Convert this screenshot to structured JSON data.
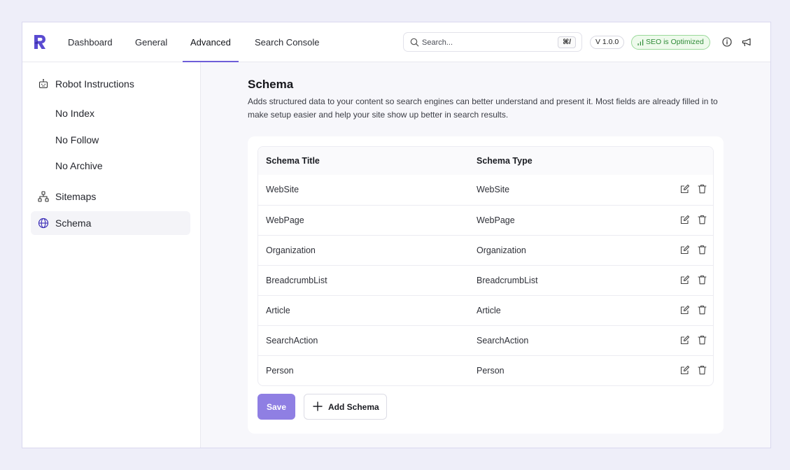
{
  "header": {
    "tabs": [
      {
        "label": "Dashboard"
      },
      {
        "label": "General"
      },
      {
        "label": "Advanced"
      },
      {
        "label": "Search Console"
      }
    ],
    "active_tab": "Advanced",
    "search": {
      "placeholder": "Search...",
      "shortcut": "⌘/"
    },
    "version": "V 1.0.0",
    "seo_status": "SEO is Optimized",
    "icons": [
      "logo-icon",
      "search-icon",
      "info-icon",
      "megaphone-icon"
    ]
  },
  "sidebar": {
    "items": [
      {
        "label": "Robot Instructions",
        "icon": "robot-icon"
      },
      {
        "label": "No Index"
      },
      {
        "label": "No Follow"
      },
      {
        "label": "No Archive"
      },
      {
        "label": "Sitemaps",
        "icon": "sitemap-icon"
      },
      {
        "label": "Schema",
        "icon": "globe-icon",
        "active": true
      }
    ]
  },
  "main": {
    "title": "Schema",
    "description": "Adds structured data to your content so search engines can better understand and present it. Most fields are already filled in to make setup easier and help your site show up better in search results.",
    "table": {
      "columns": [
        "Schema Title",
        "Schema Type"
      ],
      "rows": [
        [
          "WebSite",
          "WebSite"
        ],
        [
          "WebPage",
          "WebPage"
        ],
        [
          "Organization",
          "Organization"
        ],
        [
          "BreadcrumbList",
          "BreadcrumbList"
        ],
        [
          "Article",
          "Article"
        ],
        [
          "SearchAction",
          "SearchAction"
        ],
        [
          "Person",
          "Person"
        ]
      ]
    },
    "save_label": "Save",
    "add_label": "Add Schema"
  },
  "colors": {
    "accent": "#6e5ed8",
    "save_button": "#8f7fe3",
    "seo_green": "#2d8a36",
    "background": "#eeeef9"
  }
}
